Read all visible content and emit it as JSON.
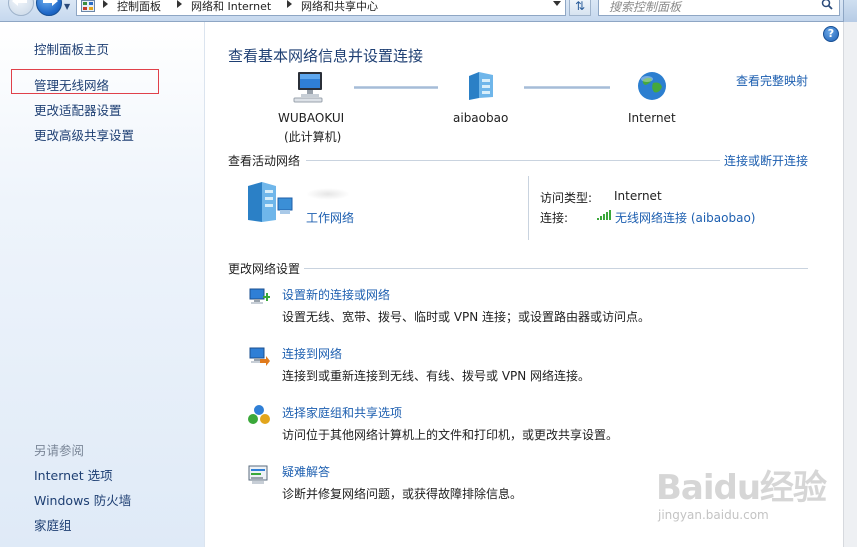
{
  "address_bar": {
    "crumbs": [
      "控制面板",
      "网络和 Internet",
      "网络和共享中心"
    ],
    "search_placeholder": "搜索控制面板"
  },
  "sidebar": {
    "home": "控制面板主页",
    "items": [
      {
        "label": "管理无线网络",
        "highlighted": true
      },
      {
        "label": "更改适配器设置"
      },
      {
        "label": "更改高级共享设置"
      }
    ],
    "see_also_title": "另请参阅",
    "see_also": [
      "Internet 选项",
      "Windows 防火墙",
      "家庭组"
    ]
  },
  "main": {
    "title": "查看基本网络信息并设置连接",
    "full_map_link": "查看完整映射",
    "nodes": [
      {
        "name": "WUBAOKUI",
        "sub": "(此计算机)",
        "icon": "computer-icon"
      },
      {
        "name": "aibaobao",
        "icon": "network-icon"
      },
      {
        "name": "Internet",
        "icon": "globe-icon"
      }
    ],
    "active_networks": {
      "title": "查看活动网络",
      "connect_link": "连接或断开连接",
      "network_type": "工作网络",
      "access_type_label": "访问类型:",
      "access_type_value": "Internet",
      "connection_label": "连接:",
      "connection_value": "无线网络连接 (aibaobao)"
    },
    "change_settings": {
      "title": "更改网络设置",
      "tasks": [
        {
          "title": "设置新的连接或网络",
          "desc": "设置无线、宽带、拨号、临时或 VPN 连接；或设置路由器或访问点。",
          "icon": "new-connection-icon"
        },
        {
          "title": "连接到网络",
          "desc": "连接到或重新连接到无线、有线、拨号或 VPN 网络连接。",
          "icon": "connect-network-icon"
        },
        {
          "title": "选择家庭组和共享选项",
          "desc": "访问位于其他网络计算机上的文件和打印机，或更改共享设置。",
          "icon": "homegroup-icon"
        },
        {
          "title": "疑难解答",
          "desc": "诊断并修复网络问题，或获得故障排除信息。",
          "icon": "troubleshoot-icon"
        }
      ]
    }
  },
  "watermark": {
    "brand": "Baidu经验",
    "url": "jingyan.baidu.com"
  },
  "colors": {
    "link": "#1d5fb0",
    "title": "#1e3f73",
    "highlight_box": "#e0404a"
  }
}
